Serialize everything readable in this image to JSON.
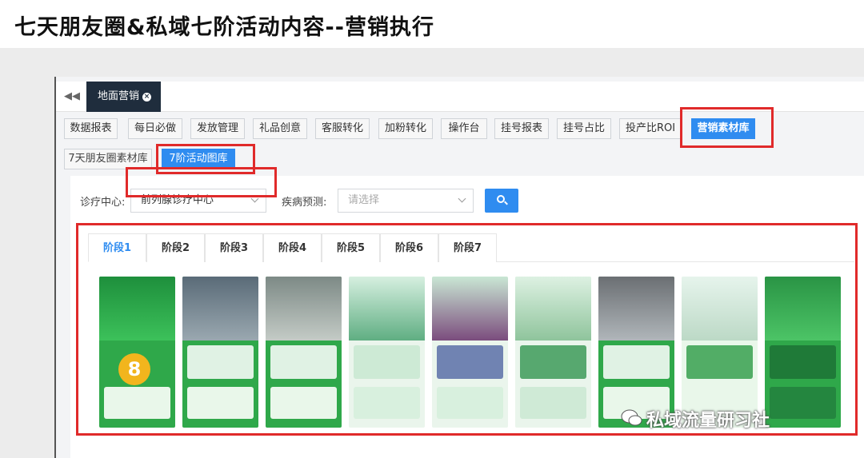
{
  "page_title": "七天朋友圈&私域七阶活动内容--营销执行",
  "tabbar": {
    "collapse": "◀◀",
    "open_tab": "地面营销",
    "close": "×"
  },
  "menu": [
    "数据报表",
    "每日必做",
    "发放管理",
    "礼品创意",
    "客服转化",
    "加粉转化",
    "操作台",
    "挂号报表",
    "挂号占比",
    "投产比ROI",
    "营销素材库"
  ],
  "submenu": [
    "7天朋友圈素材库",
    "7阶活动图库"
  ],
  "filters": {
    "center_label": "诊疗中心:",
    "center_value": "前列腺诊疗中心",
    "disease_label": "疾病预测:",
    "disease_placeholder": "请选择"
  },
  "stages": [
    "阶段1",
    "阶段2",
    "阶段3",
    "阶段4",
    "阶段5",
    "阶段6",
    "阶段7"
  ],
  "watermark": "私域流量研习社",
  "colors": {
    "accent": "#2f8cf0",
    "highlight": "#e02a2a",
    "poster_green": "#2fa84a"
  }
}
